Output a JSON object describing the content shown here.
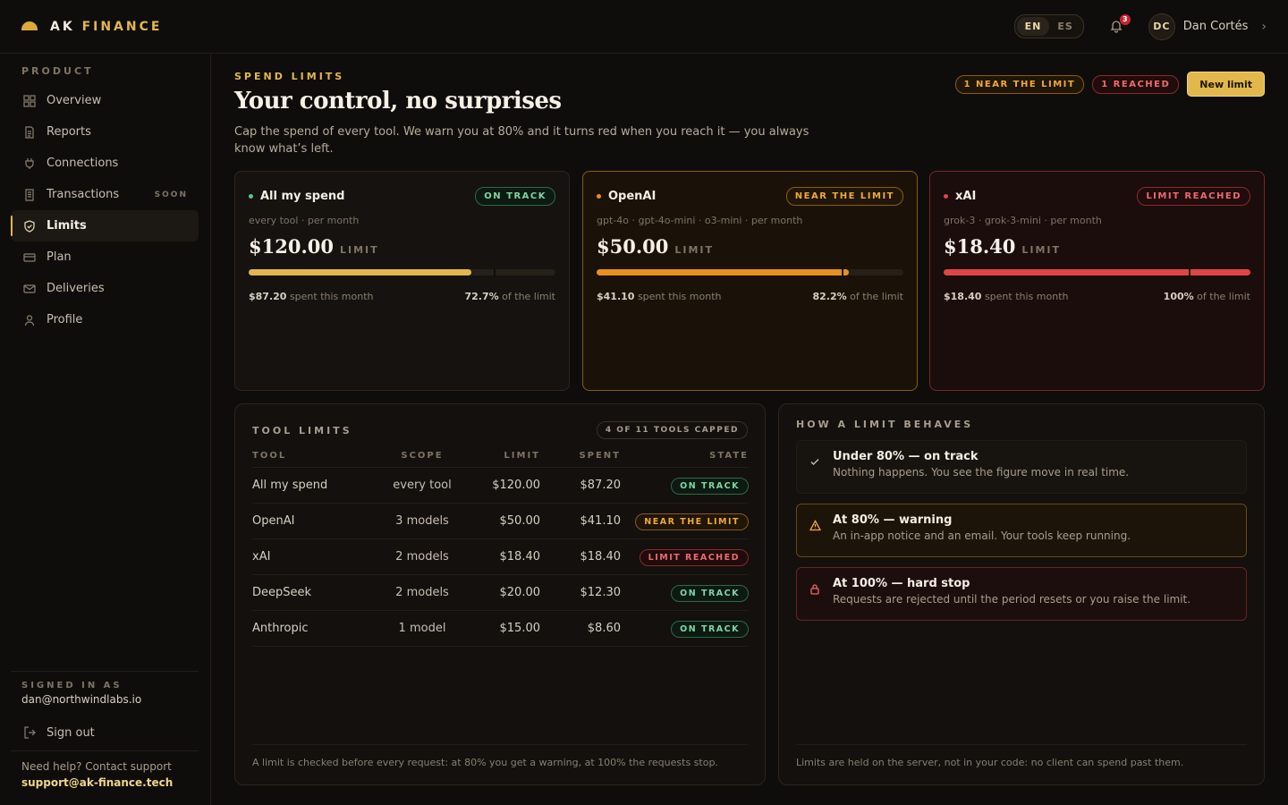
{
  "brand": {
    "part1": "AK",
    "part2": "FINANCE"
  },
  "header": {
    "lang_en": "EN",
    "lang_es": "ES",
    "notifications_count": "3",
    "user_initials": "DC",
    "user_name": "Dan Cortés",
    "chevron": "›"
  },
  "sidebar": {
    "section": "PRODUCT",
    "items": [
      {
        "label": "Overview",
        "icon": "grid-icon"
      },
      {
        "label": "Reports",
        "icon": "document-icon"
      },
      {
        "label": "Connections",
        "icon": "plug-icon"
      },
      {
        "label": "Transactions",
        "icon": "receipt-icon",
        "badge": "SOON"
      },
      {
        "label": "Limits",
        "icon": "shield-icon",
        "active": true
      },
      {
        "label": "Plan",
        "icon": "card-icon"
      },
      {
        "label": "Deliveries",
        "icon": "mail-icon"
      },
      {
        "label": "Profile",
        "icon": "user-icon"
      }
    ],
    "signed_label": "SIGNED IN AS",
    "email": "dan@northwindlabs.io",
    "sign_out": "Sign out",
    "help": "Need help? Contact support",
    "support_email": "support@ak-finance.tech"
  },
  "page": {
    "eyebrow": "SPEND LIMITS",
    "title": "Your control, no surprises",
    "description": "Cap the spend of every tool. We warn you at 80% and it turns red when you reach it — you always know what’s left.",
    "near_pill": "1 NEAR THE LIMIT",
    "reached_pill": "1 REACHED",
    "new_limit": "New limit"
  },
  "cards": [
    {
      "name": "All my spend",
      "status": "ON TRACK",
      "scope": "every tool · per month",
      "limit": "$120.00",
      "limit_label": "LIMIT",
      "spent": "$87.20",
      "spent_suffix": " spent this month",
      "pct": "72.7%",
      "pct_suffix": " of the limit",
      "fraction": 0.727,
      "color": "#e2b84c"
    },
    {
      "name": "OpenAI",
      "status": "NEAR THE LIMIT",
      "scope": "gpt-4o · gpt-4o-mini · o3-mini · per month",
      "limit": "$50.00",
      "limit_label": "LIMIT",
      "spent": "$41.10",
      "spent_suffix": " spent this month",
      "pct": "82.2%",
      "pct_suffix": " of the limit",
      "fraction": 0.822,
      "color": "#e8901e"
    },
    {
      "name": "xAI",
      "status": "LIMIT REACHED",
      "scope": "grok-3 · grok-3-mini · per month",
      "limit": "$18.40",
      "limit_label": "LIMIT",
      "spent": "$18.40",
      "spent_suffix": " spent this month",
      "pct": "100%",
      "pct_suffix": " of the limit",
      "fraction": 1.0,
      "color": "#e04646"
    }
  ],
  "tool_limits": {
    "title": "TOOL LIMITS",
    "capped": "4 OF 11 TOOLS CAPPED",
    "columns": [
      "TOOL",
      "SCOPE",
      "LIMIT",
      "SPENT",
      "STATE"
    ],
    "rows": [
      {
        "tool": "All my spend",
        "scope": "every tool",
        "limit": "$120.00",
        "spent": "$87.20",
        "state": "ON TRACK",
        "kind": "green"
      },
      {
        "tool": "OpenAI",
        "scope": "3 models",
        "limit": "$50.00",
        "spent": "$41.10",
        "state": "NEAR THE LIMIT",
        "kind": "warn"
      },
      {
        "tool": "xAI",
        "scope": "2 models",
        "limit": "$18.40",
        "spent": "$18.40",
        "state": "LIMIT REACHED",
        "kind": "red"
      },
      {
        "tool": "DeepSeek",
        "scope": "2 models",
        "limit": "$20.00",
        "spent": "$12.30",
        "state": "ON TRACK",
        "kind": "green"
      },
      {
        "tool": "Anthropic",
        "scope": "1 model",
        "limit": "$15.00",
        "spent": "$8.60",
        "state": "ON TRACK",
        "kind": "green"
      }
    ],
    "note": "A limit is checked before every request: at 80% you get a warning, at 100% the requests stop."
  },
  "behaves": {
    "title": "HOW A LIMIT BEHAVES",
    "rules": [
      {
        "title": "Under 80% — on track",
        "desc": "Nothing happens. You see the figure move in real time."
      },
      {
        "title": "At 80% — warning",
        "desc": "An in-app notice and an email. Your tools keep running."
      },
      {
        "title": "At 100% — hard stop",
        "desc": "Requests are rejected until the period resets or you raise the limit."
      }
    ],
    "note": "Limits are held on the server, not in your code: no client can spend past them."
  }
}
